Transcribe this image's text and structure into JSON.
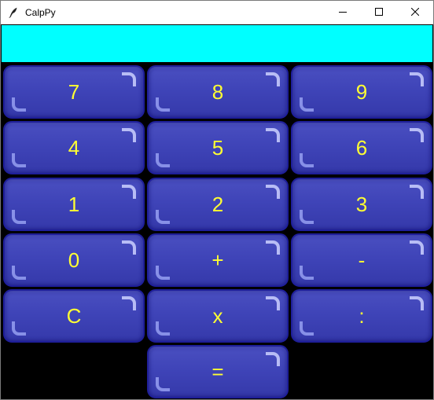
{
  "window": {
    "title": "CalpPy",
    "icon": "feather-icon",
    "controls": [
      "minimize-icon",
      "maximize-icon",
      "close-icon"
    ]
  },
  "display": {
    "value": "",
    "background": "#00ffff"
  },
  "keypad": {
    "button_color": "#3f44b8",
    "label_color": "#ffff33",
    "keys": {
      "k7": "7",
      "k8": "8",
      "k9": "9",
      "k4": "4",
      "k5": "5",
      "k6": "6",
      "k1": "1",
      "k2": "2",
      "k3": "3",
      "k0": "0",
      "plus": "+",
      "minus": "-",
      "clear": "C",
      "multiply": "x",
      "divide": ":",
      "equals": "="
    }
  }
}
